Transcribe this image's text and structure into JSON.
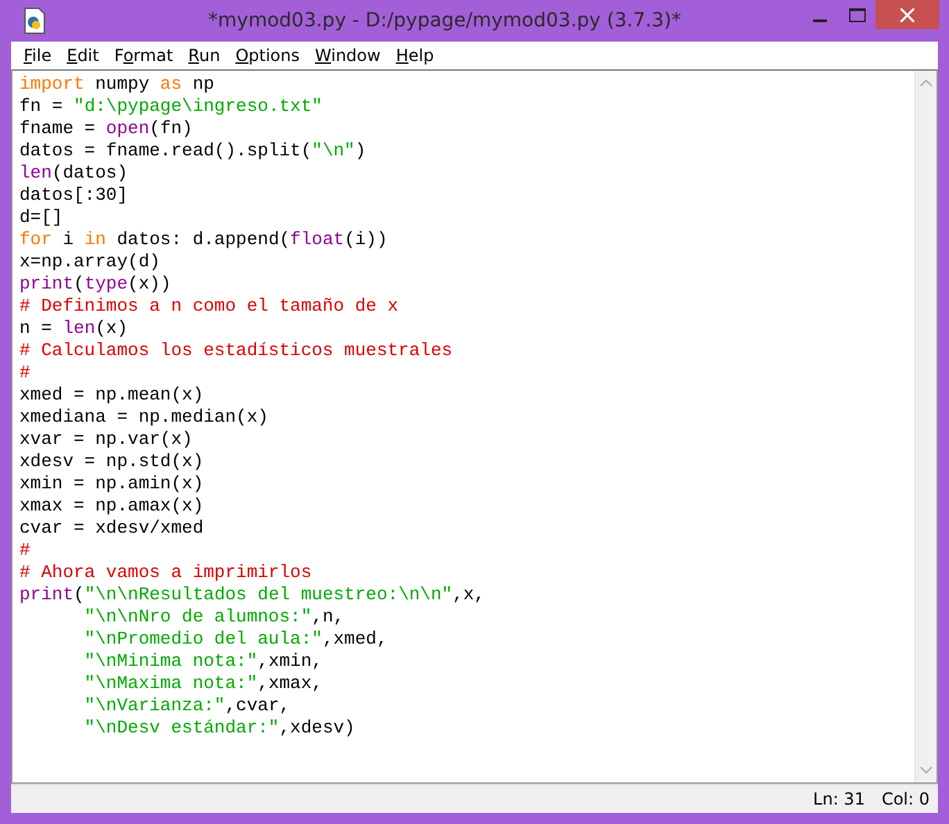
{
  "window": {
    "title": "*mymod03.py - D:/pypage/mymod03.py (3.7.3)*"
  },
  "menu": [
    {
      "key": "F",
      "post": "ile"
    },
    {
      "key": "E",
      "post": "dit"
    },
    {
      "pre": "F",
      "key": "o",
      "post": "rmat"
    },
    {
      "key": "R",
      "post": "un"
    },
    {
      "key": "O",
      "post": "ptions"
    },
    {
      "key": "W",
      "post": "indow"
    },
    {
      "key": "H",
      "post": "elp"
    }
  ],
  "code_lines": [
    [
      {
        "kind": "keyword",
        "text": "import"
      },
      {
        "kind": "plain",
        "text": " numpy "
      },
      {
        "kind": "keyword",
        "text": "as"
      },
      {
        "kind": "plain",
        "text": " np"
      }
    ],
    [
      {
        "kind": "plain",
        "text": "fn = "
      },
      {
        "kind": "string",
        "text": "\"d:\\pypage\\ingreso.txt\""
      }
    ],
    [
      {
        "kind": "plain",
        "text": "fname = "
      },
      {
        "kind": "builtin",
        "text": "open"
      },
      {
        "kind": "plain",
        "text": "(fn)"
      }
    ],
    [
      {
        "kind": "plain",
        "text": "datos = fname.read().split("
      },
      {
        "kind": "string",
        "text": "\"\\n\""
      },
      {
        "kind": "plain",
        "text": ")"
      }
    ],
    [
      {
        "kind": "builtin",
        "text": "len"
      },
      {
        "kind": "plain",
        "text": "(datos)"
      }
    ],
    [
      {
        "kind": "plain",
        "text": "datos[:30]"
      }
    ],
    [
      {
        "kind": "plain",
        "text": "d=[]"
      }
    ],
    [
      {
        "kind": "keyword",
        "text": "for"
      },
      {
        "kind": "plain",
        "text": " i "
      },
      {
        "kind": "keyword",
        "text": "in"
      },
      {
        "kind": "plain",
        "text": " datos: d.append("
      },
      {
        "kind": "builtin",
        "text": "float"
      },
      {
        "kind": "plain",
        "text": "(i))"
      }
    ],
    [
      {
        "kind": "plain",
        "text": "x=np.array(d)"
      }
    ],
    [
      {
        "kind": "builtin",
        "text": "print"
      },
      {
        "kind": "plain",
        "text": "("
      },
      {
        "kind": "builtin",
        "text": "type"
      },
      {
        "kind": "plain",
        "text": "(x))"
      }
    ],
    [
      {
        "kind": "comment",
        "text": "# Definimos a n como el tamaño de x"
      }
    ],
    [
      {
        "kind": "plain",
        "text": "n = "
      },
      {
        "kind": "builtin",
        "text": "len"
      },
      {
        "kind": "plain",
        "text": "(x)"
      }
    ],
    [
      {
        "kind": "comment",
        "text": "# Calculamos los estadísticos muestrales"
      }
    ],
    [
      {
        "kind": "comment",
        "text": "#"
      }
    ],
    [
      {
        "kind": "plain",
        "text": "xmed = np.mean(x)"
      }
    ],
    [
      {
        "kind": "plain",
        "text": "xmediana = np.median(x)"
      }
    ],
    [
      {
        "kind": "plain",
        "text": "xvar = np.var(x)"
      }
    ],
    [
      {
        "kind": "plain",
        "text": "xdesv = np.std(x)"
      }
    ],
    [
      {
        "kind": "plain",
        "text": "xmin = np.amin(x)"
      }
    ],
    [
      {
        "kind": "plain",
        "text": "xmax = np.amax(x)"
      }
    ],
    [
      {
        "kind": "plain",
        "text": "cvar = xdesv/xmed"
      }
    ],
    [
      {
        "kind": "comment",
        "text": "#"
      }
    ],
    [
      {
        "kind": "comment",
        "text": "# Ahora vamos a imprimirlos"
      }
    ],
    [
      {
        "kind": "builtin",
        "text": "print"
      },
      {
        "kind": "plain",
        "text": "("
      },
      {
        "kind": "string",
        "text": "\"\\n\\nResultados del muestreo:\\n\\n\""
      },
      {
        "kind": "plain",
        "text": ",x,"
      }
    ],
    [
      {
        "kind": "string",
        "text": "      \"\\n\\nNro de alumnos:\""
      },
      {
        "kind": "plain",
        "text": ",n,"
      }
    ],
    [
      {
        "kind": "string",
        "text": "      \"\\nPromedio del aula:\""
      },
      {
        "kind": "plain",
        "text": ",xmed,"
      }
    ],
    [
      {
        "kind": "string",
        "text": "      \"\\nMinima nota:\""
      },
      {
        "kind": "plain",
        "text": ",xmin,"
      }
    ],
    [
      {
        "kind": "string",
        "text": "      \"\\nMaxima nota:\""
      },
      {
        "kind": "plain",
        "text": ",xmax,"
      }
    ],
    [
      {
        "kind": "string",
        "text": "      \"\\nVarianza:\""
      },
      {
        "kind": "plain",
        "text": ",cvar,"
      }
    ],
    [
      {
        "kind": "string",
        "text": "      \"\\nDesv estándar:\""
      },
      {
        "kind": "plain",
        "text": ",xdesv)"
      }
    ]
  ],
  "status_bar": {
    "line": "Ln: 31",
    "column": "Col: 0"
  }
}
